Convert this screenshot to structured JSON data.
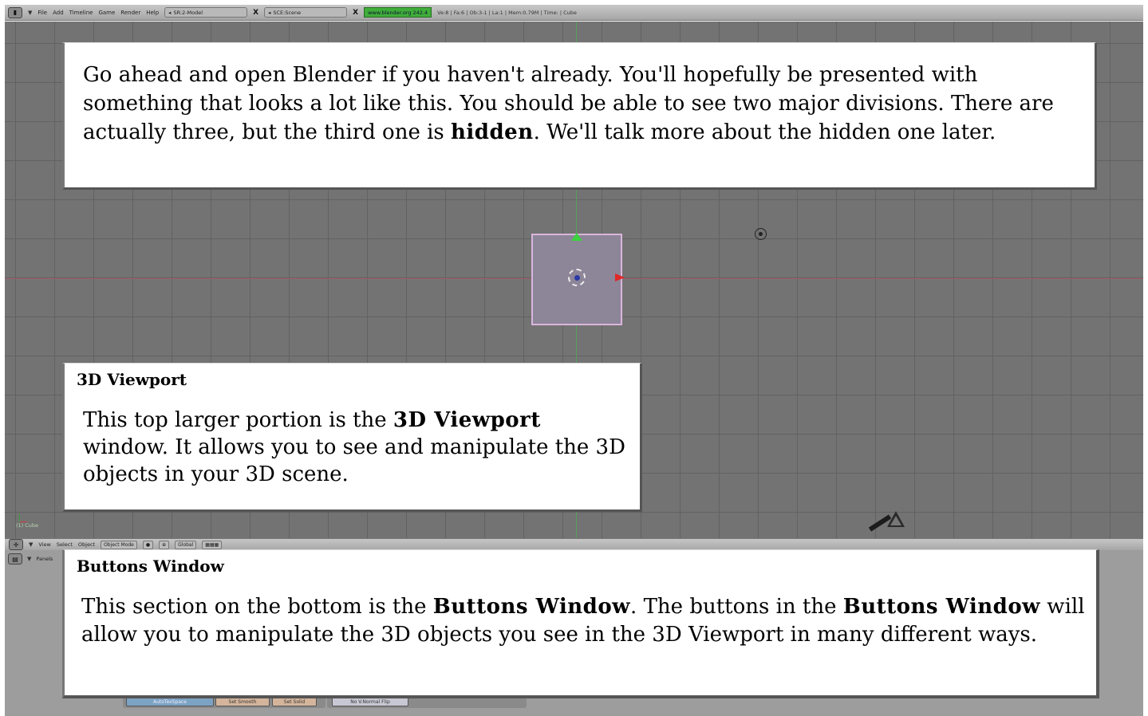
{
  "topbar": {
    "menus": [
      "File",
      "Add",
      "Timeline",
      "Game",
      "Render",
      "Help"
    ],
    "screen_field": "SR:2-Model",
    "scene_field": "SCE:Scene",
    "url_label": "www.blender.org 242.4",
    "stats": "Ve:8 | Fa:6 | Ob:3-1 | La:1   | Mem:0.79M   | Time: | Cube"
  },
  "viewport": {
    "object_label": "(1) Cube"
  },
  "viewport_header": {
    "menus": [
      "View",
      "Select",
      "Object"
    ],
    "mode": "Object Mode",
    "orientation": "Global"
  },
  "buttons_window": {
    "header_label": "Panels",
    "autotex_label": "AutoTexSpace",
    "set_smooth_label": "Set Smooth",
    "set_solid_label": "Set Solid",
    "no_v_normal_flip_label": "No V.Normal Flip"
  },
  "notes": {
    "intro": {
      "part1": "Go ahead and open Blender if you haven't already. You'll hopefully be presented with something that looks a lot like this. You should be able to see two major divisions. There are actually three, but the third one is ",
      "bold": "hidden",
      "part2": ". We'll talk more about the hidden one later."
    },
    "viewport": {
      "title": "3D Viewport",
      "part1": "This top larger portion is the ",
      "bold": "3D Viewport",
      "part2": " window. It allows you to see and manipulate the 3D objects in your 3D scene."
    },
    "buttons": {
      "title": "Buttons Window",
      "part1": "This section on the bottom is the ",
      "bold1": "Buttons Window",
      "part2": ". The buttons in the ",
      "bold2": "Buttons Window",
      "part3": " will allow you to manipulate the 3D objects you see in the 3D Viewport in many different ways."
    }
  }
}
